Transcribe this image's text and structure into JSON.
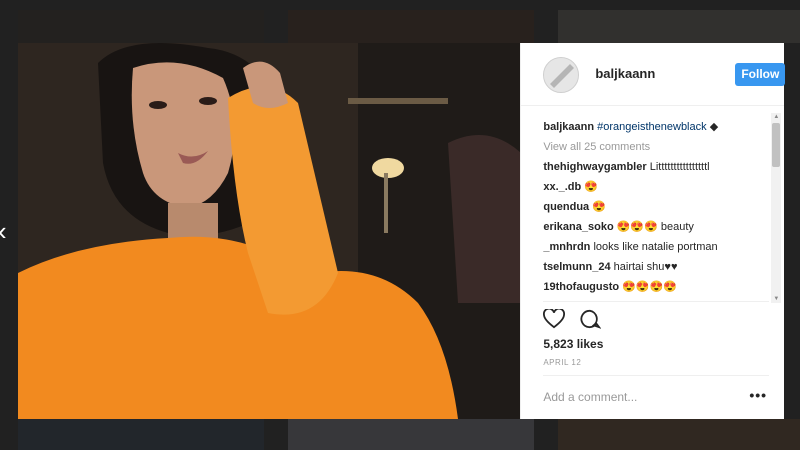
{
  "post": {
    "username": "baljkaann",
    "follow_label": "Follow",
    "caption_user": "baljkaann",
    "caption_hashtag": "#orangeisthenewblack",
    "caption_emoji": "◆",
    "view_all": "View all 25 comments",
    "comments": [
      {
        "user": "thehighwaygambler",
        "text": "Littttttttttttttttl"
      },
      {
        "user": "xx._.db",
        "text": "😍"
      },
      {
        "user": "quendua",
        "text": "😍"
      },
      {
        "user": "erikana_soko",
        "text": "😍😍😍 beauty"
      },
      {
        "user": "_mnhrdn",
        "text": "looks like natalie portman"
      },
      {
        "user": "tselmunn_24",
        "text": "hairtai shu♥♥"
      },
      {
        "user": "19thofaugusto",
        "text": "😍😍😍😍"
      }
    ],
    "likes": "5,823 likes",
    "date": "APRIL 12",
    "add_comment_placeholder": "Add a comment...",
    "more_label": "•••"
  },
  "nav": {
    "prev_label": "‹"
  },
  "colors": {
    "follow_bg": "#3897f0",
    "hashtag": "#003569",
    "sweater": "#f28a1f"
  }
}
